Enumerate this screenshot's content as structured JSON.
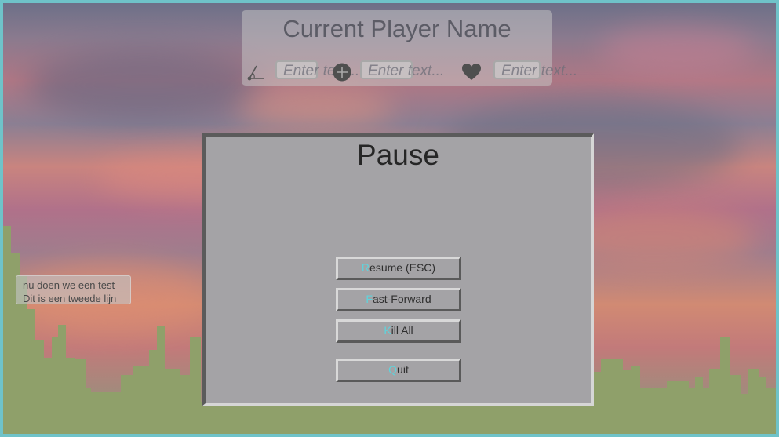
{
  "colors": {
    "frame": "#6fc3c9",
    "skyline": "#8fa06a",
    "panel": "#a4a3a6",
    "hotkey": "#5fd3dc"
  },
  "hud": {
    "player_name": "Current Player Name",
    "stats": [
      {
        "icon": "angle-icon",
        "placeholder": "Enter text..."
      },
      {
        "icon": "plus-circle-icon",
        "placeholder": "Enter text..."
      },
      {
        "icon": "heart-icon",
        "placeholder": "Enter text..."
      }
    ]
  },
  "pause_menu": {
    "title": "Pause",
    "buttons": [
      {
        "hotkey": "R",
        "rest": "esume (ESC)"
      },
      {
        "hotkey": "F",
        "rest": "ast-Forward"
      },
      {
        "hotkey": "K",
        "rest": "ill All"
      },
      {
        "hotkey": "Q",
        "rest": "uit"
      }
    ]
  },
  "tooltip": {
    "line1": "nu doen we een test",
    "line2": "Dit is een tweede lijn"
  }
}
